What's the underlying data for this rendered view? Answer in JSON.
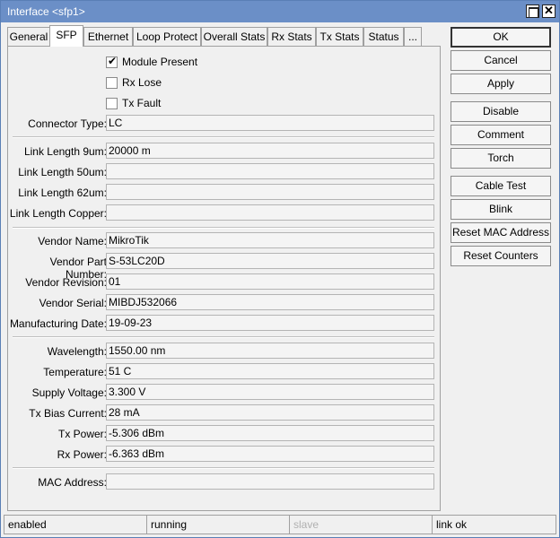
{
  "window": {
    "title": "Interface <sfp1>"
  },
  "tabs": [
    "General",
    "SFP",
    "Ethernet",
    "Loop Protect",
    "Overall Stats",
    "Rx Stats",
    "Tx Stats",
    "Status",
    "..."
  ],
  "active_tab": "SFP",
  "checkboxes": [
    {
      "label": "Module Present",
      "checked": true
    },
    {
      "label": "Rx Lose",
      "checked": false
    },
    {
      "label": "Tx Fault",
      "checked": false
    }
  ],
  "fields": {
    "connector_type": {
      "label": "Connector Type:",
      "value": "LC"
    },
    "link_length_9um": {
      "label": "Link Length 9um:",
      "value": "20000 m"
    },
    "link_length_50um": {
      "label": "Link Length 50um:",
      "value": ""
    },
    "link_length_62um": {
      "label": "Link Length 62um:",
      "value": ""
    },
    "link_length_copper": {
      "label": "Link Length Copper:",
      "value": ""
    },
    "vendor_name": {
      "label": "Vendor Name:",
      "value": "MikroTik"
    },
    "vendor_part_number": {
      "label": "Vendor Part Number:",
      "value": "S-53LC20D"
    },
    "vendor_revision": {
      "label": "Vendor Revision:",
      "value": "01"
    },
    "vendor_serial": {
      "label": "Vendor Serial:",
      "value": "MIBDJ532066"
    },
    "manufacturing_date": {
      "label": "Manufacturing Date:",
      "value": "19-09-23"
    },
    "wavelength": {
      "label": "Wavelength:",
      "value": "1550.00 nm"
    },
    "temperature": {
      "label": "Temperature:",
      "value": "51 C"
    },
    "supply_voltage": {
      "label": "Supply Voltage:",
      "value": "3.300 V"
    },
    "tx_bias_current": {
      "label": "Tx Bias Current:",
      "value": "28 mA"
    },
    "tx_power": {
      "label": "Tx Power:",
      "value": "-5.306 dBm"
    },
    "rx_power": {
      "label": "Rx Power:",
      "value": "-6.363 dBm"
    },
    "mac_address": {
      "label": "MAC Address:",
      "value": ""
    }
  },
  "buttons": {
    "ok": "OK",
    "cancel": "Cancel",
    "apply": "Apply",
    "disable": "Disable",
    "comment": "Comment",
    "torch": "Torch",
    "cable_test": "Cable Test",
    "blink": "Blink",
    "reset_mac": "Reset MAC Address",
    "reset_counters": "Reset Counters"
  },
  "statusbar": [
    "enabled",
    "running",
    "slave",
    "link ok"
  ],
  "icons": {
    "maximize": "maximize-icon",
    "close": "close-icon",
    "check": "checkmark-icon"
  },
  "colors": {
    "titlebar": "#6b8fc7",
    "window_bg": "#f0f0f0",
    "field_bg": "#f4f4f4",
    "disabled_text": "#b0b0b0"
  }
}
